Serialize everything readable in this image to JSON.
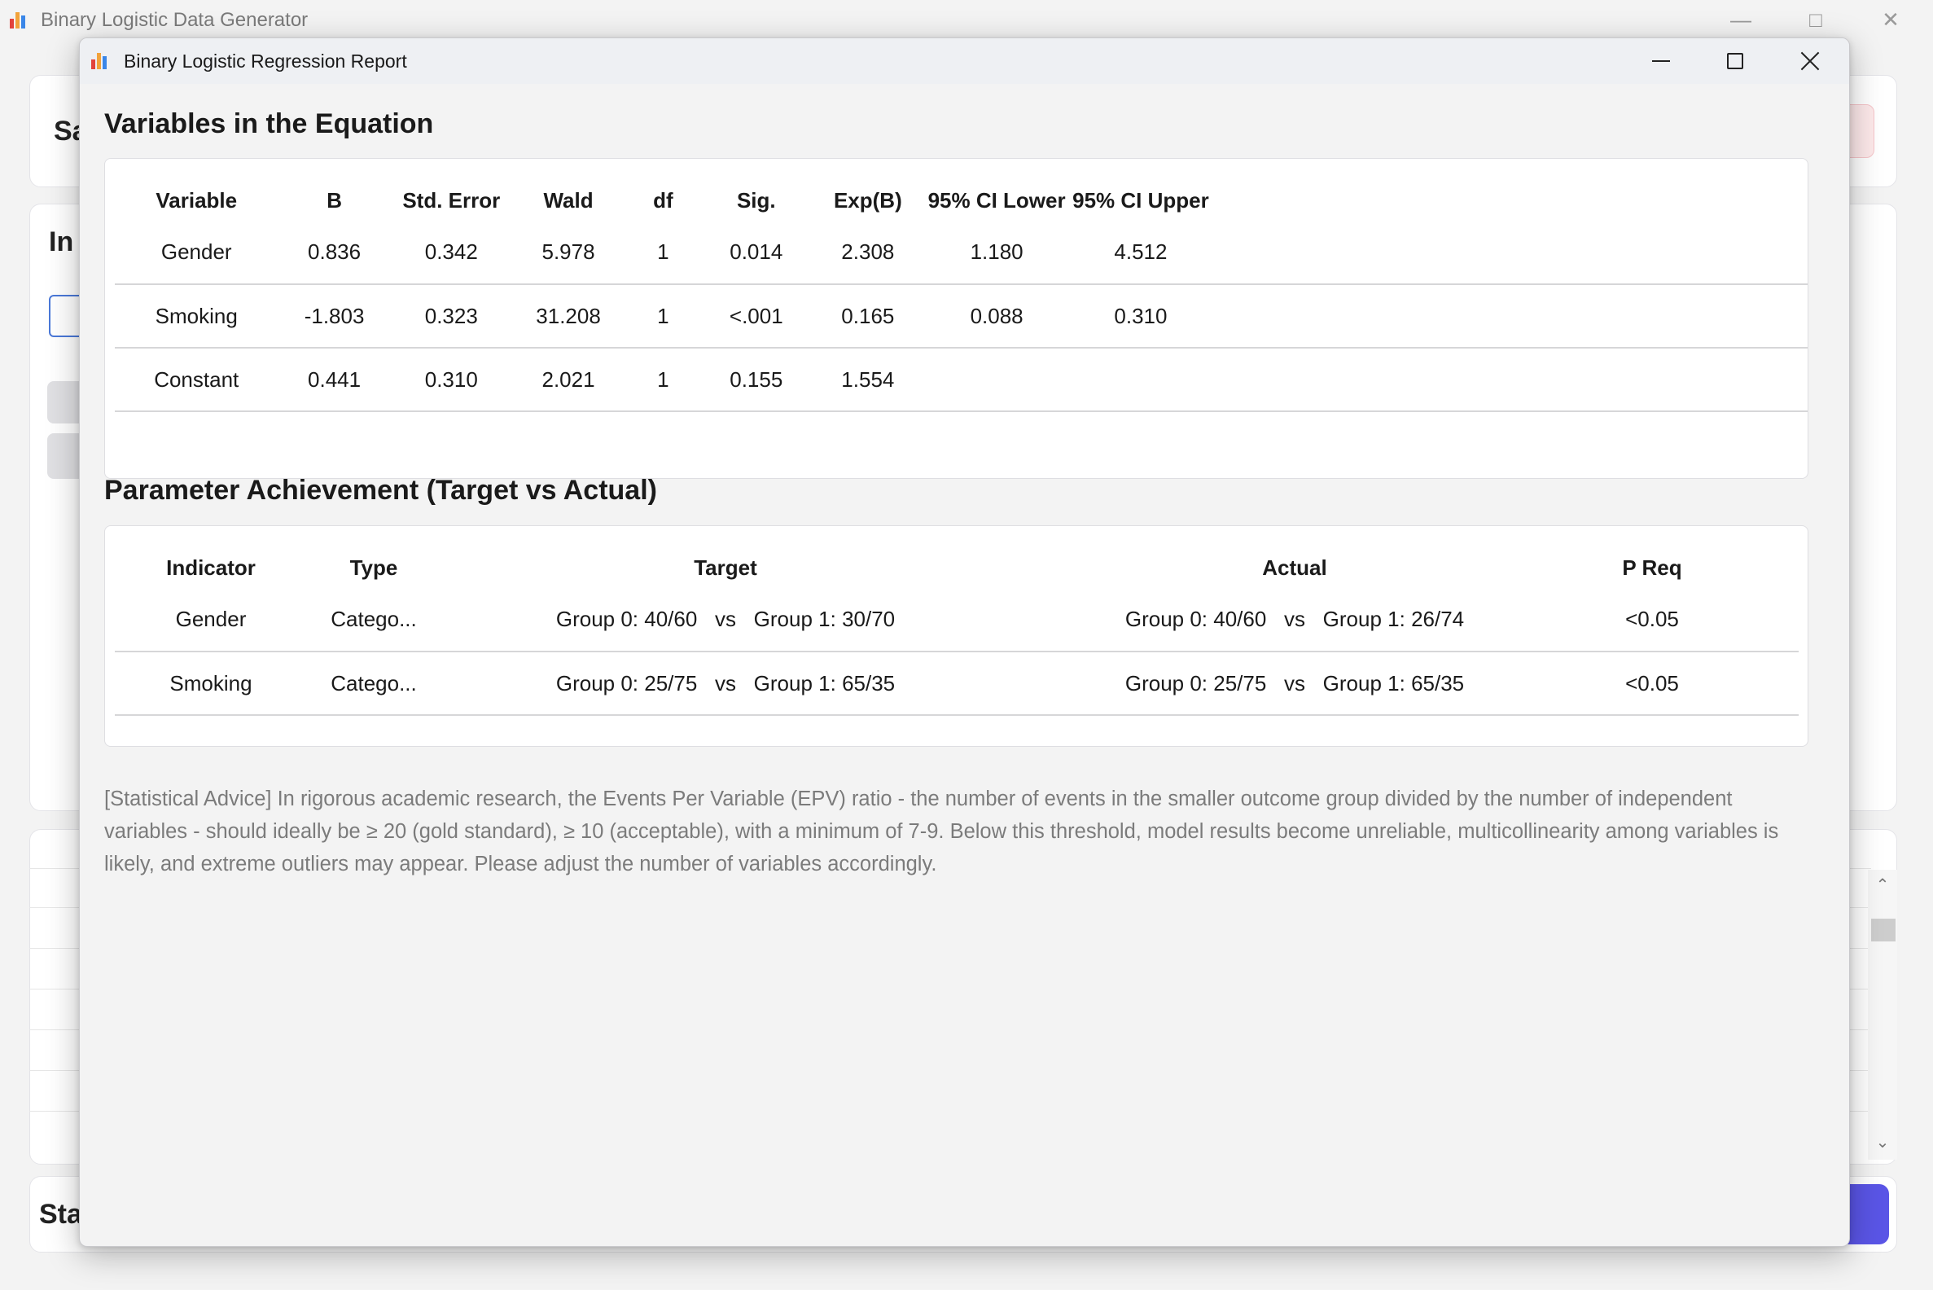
{
  "background_window": {
    "title": "Binary Logistic Data Generator",
    "partial_texts": [
      "Sa",
      "In",
      "Sta"
    ]
  },
  "colors": {
    "icon_bar_red": "#e2433c",
    "icon_bar_orange": "#f2a23a",
    "icon_bar_blue": "#3a86e8",
    "primary_button": "#5a55e6",
    "danger_button_bg": "#fde9ea"
  },
  "dialog": {
    "title": "Binary Logistic Regression Report",
    "controls": {
      "minimize": "minimize-icon",
      "maximize": "maximize-icon",
      "close": "close-icon"
    }
  },
  "equation": {
    "title": "Variables in the Equation",
    "headers": [
      "Variable",
      "B",
      "Std. Error",
      "Wald",
      "df",
      "Sig.",
      "Exp(B)",
      "95% CI Lower",
      "95% CI Upper"
    ],
    "rows": [
      [
        "Gender",
        "0.836",
        "0.342",
        "5.978",
        "1",
        "0.014",
        "2.308",
        "1.180",
        "4.512"
      ],
      [
        "Smoking",
        "-1.803",
        "0.323",
        "31.208",
        "1",
        "<.001",
        "0.165",
        "0.088",
        "0.310"
      ],
      [
        "Constant",
        "0.441",
        "0.310",
        "2.021",
        "1",
        "0.155",
        "1.554",
        "",
        ""
      ]
    ]
  },
  "achievement": {
    "title": "Parameter Achievement (Target vs Actual)",
    "headers": [
      "Indicator",
      "Type",
      "Target",
      "Actual",
      "P Req"
    ],
    "vs_label": "vs",
    "rows": [
      {
        "indicator": "Gender",
        "type": "Catego...",
        "target_g0": "Group 0: 40/60",
        "target_g1": "Group 1: 30/70",
        "actual_g0": "Group 0: 40/60",
        "actual_g1": "Group 1: 26/74",
        "p_req": "<0.05"
      },
      {
        "indicator": "Smoking",
        "type": "Catego...",
        "target_g0": "Group 0: 25/75",
        "target_g1": "Group 1: 65/35",
        "actual_g0": "Group 0: 25/75",
        "actual_g1": "Group 1: 65/35",
        "p_req": "<0.05"
      }
    ]
  },
  "advice": "[Statistical Advice] In rigorous academic research, the Events Per Variable (EPV) ratio - the number of events in the smaller outcome group divided by the number of independent variables - should ideally be ≥ 20 (gold standard), ≥ 10 (acceptable), with a minimum of 7-9. Below this threshold, model results become unreliable, multicollinearity among variables is likely, and extreme outliers may appear. Please adjust the number of variables accordingly."
}
